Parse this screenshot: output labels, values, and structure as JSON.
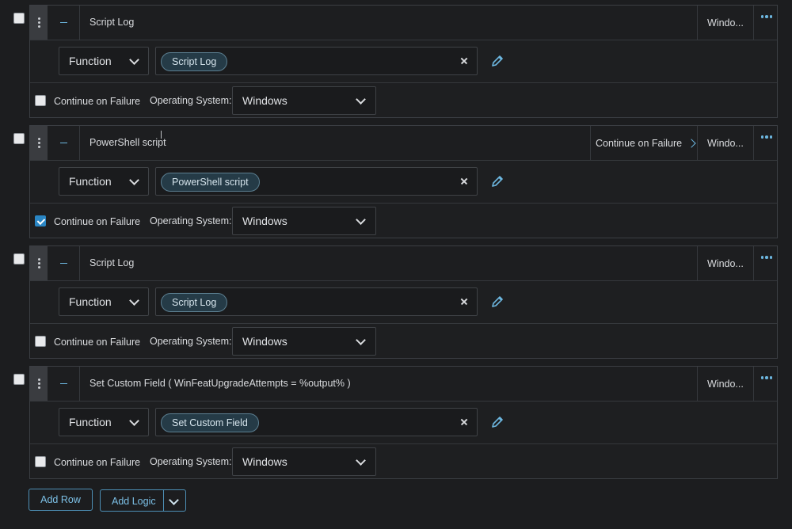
{
  "rows": [
    {
      "title": "Script Log",
      "header_continue_on_failure": "",
      "header_os": "Windo...",
      "function_select": "Function",
      "function_value": "Script Log",
      "continue_on_failure_label": "Continue on Failure",
      "continue_on_failure_checked": false,
      "os_label": "Operating System:",
      "os_value": "Windows"
    },
    {
      "title": "PowerShell script",
      "header_continue_on_failure": "Continue on Failure",
      "header_os": "Windo...",
      "function_select": "Function",
      "function_value": "PowerShell script",
      "continue_on_failure_label": "Continue on Failure",
      "continue_on_failure_checked": true,
      "os_label": "Operating System:",
      "os_value": "Windows"
    },
    {
      "title": "Script Log",
      "header_continue_on_failure": "",
      "header_os": "Windo...",
      "function_select": "Function",
      "function_value": "Script Log",
      "continue_on_failure_label": "Continue on Failure",
      "continue_on_failure_checked": false,
      "os_label": "Operating System:",
      "os_value": "Windows"
    },
    {
      "title": "Set Custom Field ( WinFeatUpgradeAttempts = %output% )",
      "header_continue_on_failure": "",
      "header_os": "Windo...",
      "function_select": "Function",
      "function_value": "Set Custom Field",
      "continue_on_failure_label": "Continue on Failure",
      "continue_on_failure_checked": false,
      "os_label": "Operating System:",
      "os_value": "Windows"
    }
  ],
  "footer": {
    "add_row_label": "Add Row",
    "add_logic_label": "Add Logic"
  },
  "icons": {
    "drag": "drag-handle-icon",
    "collapse": "minus-icon",
    "more": "more-horizontal-icon",
    "clear": "close-icon",
    "edit": "pencil-icon",
    "dropdown": "chevron-down-icon",
    "expand": "chevron-right-icon"
  },
  "colors": {
    "background": "#1c1d1f",
    "accent": "#6db7e0",
    "chip_bg": "#253b47",
    "checkbox_checked": "#2a86c4"
  }
}
